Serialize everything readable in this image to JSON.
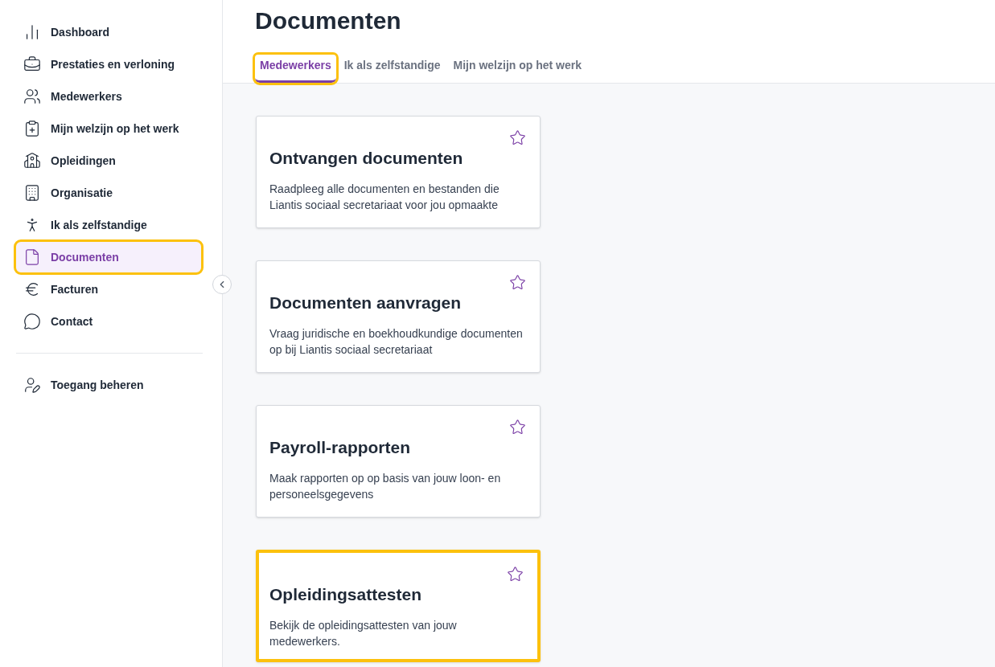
{
  "sidebar": {
    "items": [
      {
        "label": "Dashboard",
        "selected": false,
        "highlighted": false
      },
      {
        "label": "Prestaties en verloning",
        "selected": false,
        "highlighted": false
      },
      {
        "label": "Medewerkers",
        "selected": false,
        "highlighted": false
      },
      {
        "label": "Mijn welzijn op het werk",
        "selected": false,
        "highlighted": false
      },
      {
        "label": "Opleidingen",
        "selected": false,
        "highlighted": false
      },
      {
        "label": "Organisatie",
        "selected": false,
        "highlighted": false
      },
      {
        "label": "Ik als zelfstandige",
        "selected": false,
        "highlighted": false
      },
      {
        "label": "Documenten",
        "selected": true,
        "highlighted": true
      },
      {
        "label": "Facturen",
        "selected": false,
        "highlighted": false
      },
      {
        "label": "Contact",
        "selected": false,
        "highlighted": false
      }
    ],
    "footer_items": [
      {
        "label": "Toegang beheren",
        "selected": false,
        "highlighted": false
      }
    ]
  },
  "page": {
    "title": "Documenten"
  },
  "tabs": [
    {
      "label": "Medewerkers",
      "selected": true,
      "highlighted": true
    },
    {
      "label": "Ik als zelfstandige",
      "selected": false,
      "highlighted": false
    },
    {
      "label": "Mijn welzijn op het werk",
      "selected": false,
      "highlighted": false
    }
  ],
  "cards": [
    {
      "title": "Ontvangen documenten",
      "description": "Raadpleeg alle documenten en bestanden die Liantis sociaal secretariaat voor jou opmaakte",
      "favorite": false,
      "highlighted": false
    },
    {
      "title": "Documenten aanvragen",
      "description": "Vraag juridische en boekhoudkundige documenten op bij Liantis sociaal secretariaat",
      "favorite": false,
      "highlighted": false
    },
    {
      "title": "Payroll-rapporten",
      "description": "Maak rapporten op op basis van jouw loon- en personeelsgegevens",
      "favorite": false,
      "highlighted": false
    },
    {
      "title": "Opleidingsattesten",
      "description": "Bekijk de opleidingsattesten van jouw medewerkers.",
      "favorite": false,
      "highlighted": true
    }
  ]
}
